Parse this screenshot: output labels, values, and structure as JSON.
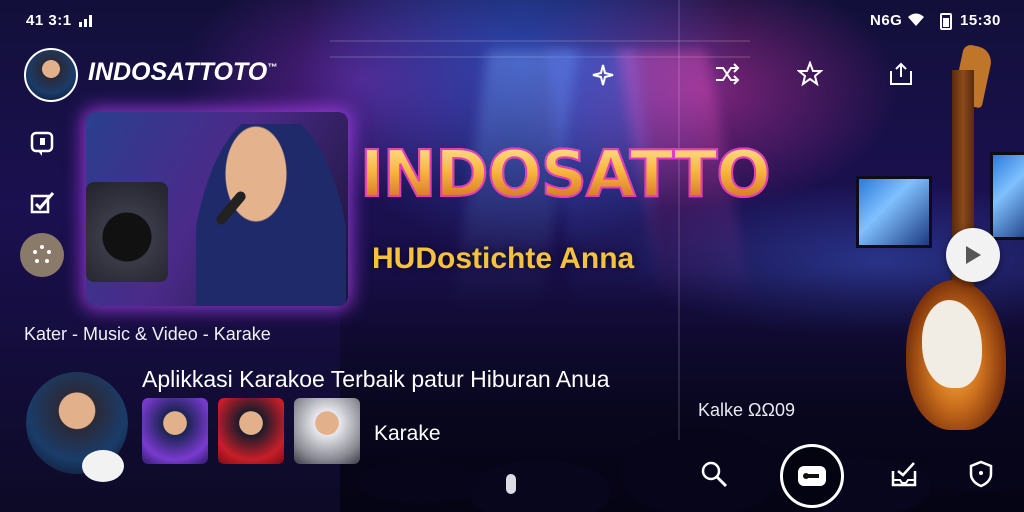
{
  "status_bar": {
    "time_left": "41 3:1",
    "right_text": "N6G",
    "time_right": "15:30"
  },
  "app": {
    "name": "INDOSATTOTO",
    "trademark": "™"
  },
  "banner": {
    "logo_text": "INDOSATTO",
    "tagline": "HUDostichte Anna"
  },
  "category_line": "Kater - Music & Video - Karake",
  "headline": "Aplikkasi Karakoe Terbaik patur Hiburan Anua",
  "row_label": "Karake",
  "right_panel_caption": "Kalke ΩΩ09",
  "icons": {
    "top_sparkle": "sparkle-icon",
    "top_shuffle": "shuffle-icon",
    "top_star": "star-icon",
    "top_share": "share-icon",
    "side_chat": "chat-icon",
    "side_edit": "edit-check-icon",
    "side_loading": "loading-icon",
    "bottom_search": "search-icon",
    "bottom_fab": "karaoke-icon",
    "bottom_inbox": "inbox-icon",
    "bottom_shield": "shield-icon",
    "play": "play-icon"
  },
  "colors": {
    "accent_gold": "#f6c23e",
    "accent_magenta": "#e33cbf",
    "glow_purple": "#be46ff"
  }
}
